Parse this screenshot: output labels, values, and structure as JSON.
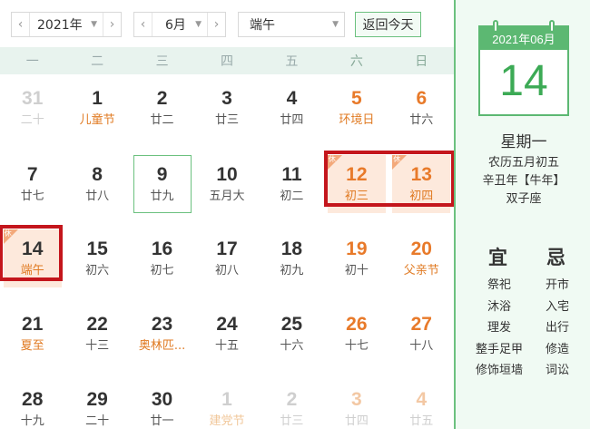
{
  "toolbar": {
    "year_value": "2021年",
    "month_value": "6月",
    "holiday_value": "端午",
    "today_button": "返回今天"
  },
  "weekdays": [
    "一",
    "二",
    "三",
    "四",
    "五",
    "六",
    "日"
  ],
  "calendar": {
    "rows": [
      [
        {
          "day": "31",
          "lunar": "二十",
          "other": true
        },
        {
          "day": "1",
          "lunar": "儿童节",
          "festival": true
        },
        {
          "day": "2",
          "lunar": "廿二"
        },
        {
          "day": "3",
          "lunar": "廿三"
        },
        {
          "day": "4",
          "lunar": "廿四"
        },
        {
          "day": "5",
          "lunar": "环境日",
          "festival": true,
          "weekend": true
        },
        {
          "day": "6",
          "lunar": "廿六",
          "weekend": true
        }
      ],
      [
        {
          "day": "7",
          "lunar": "廿七"
        },
        {
          "day": "8",
          "lunar": "廿八"
        },
        {
          "day": "9",
          "lunar": "廿九",
          "selected": true
        },
        {
          "day": "10",
          "lunar": "五月大"
        },
        {
          "day": "11",
          "lunar": "初二"
        },
        {
          "day": "12",
          "lunar": "初三",
          "rest": true,
          "weekend": true
        },
        {
          "day": "13",
          "lunar": "初四",
          "rest": true,
          "weekend": true
        }
      ],
      [
        {
          "day": "14",
          "lunar": "端午",
          "today": true,
          "festival": true
        },
        {
          "day": "15",
          "lunar": "初六"
        },
        {
          "day": "16",
          "lunar": "初七"
        },
        {
          "day": "17",
          "lunar": "初八"
        },
        {
          "day": "18",
          "lunar": "初九"
        },
        {
          "day": "19",
          "lunar": "初十",
          "weekend": true
        },
        {
          "day": "20",
          "lunar": "父亲节",
          "festival": true,
          "weekend": true
        }
      ],
      [
        {
          "day": "21",
          "lunar": "夏至",
          "festival": true
        },
        {
          "day": "22",
          "lunar": "十三"
        },
        {
          "day": "23",
          "lunar": "奥林匹...",
          "festival": true
        },
        {
          "day": "24",
          "lunar": "十五"
        },
        {
          "day": "25",
          "lunar": "十六"
        },
        {
          "day": "26",
          "lunar": "十七",
          "weekend": true
        },
        {
          "day": "27",
          "lunar": "十八",
          "weekend": true
        }
      ],
      [
        {
          "day": "28",
          "lunar": "十九"
        },
        {
          "day": "29",
          "lunar": "二十"
        },
        {
          "day": "30",
          "lunar": "廿一"
        },
        {
          "day": "1",
          "lunar": "建党节",
          "other": true,
          "festival": true
        },
        {
          "day": "2",
          "lunar": "廿三",
          "other": true
        },
        {
          "day": "3",
          "lunar": "廿四",
          "other": true,
          "weekend": true
        },
        {
          "day": "4",
          "lunar": "廿五",
          "other": true,
          "weekend": true
        }
      ]
    ],
    "rest_badge": "休"
  },
  "side": {
    "card_header": "2021年06月",
    "card_day": "14",
    "weekday": "星期一",
    "lunar_date": "农历五月初五",
    "ganzhi": "辛丑年【牛年】",
    "zodiac": "双子座",
    "yi_title": "宜",
    "ji_title": "忌",
    "yi_items": [
      "祭祀",
      "沐浴",
      "理发",
      "整手足甲",
      "修饰垣墙"
    ],
    "ji_items": [
      "开市",
      "入宅",
      "出行",
      "修造",
      "词讼"
    ]
  },
  "colors": {
    "accent_green": "#5cb872",
    "highlight_red": "#c4161c",
    "weekend_orange": "#e87a2a",
    "rest_bg": "#fde9dc"
  }
}
